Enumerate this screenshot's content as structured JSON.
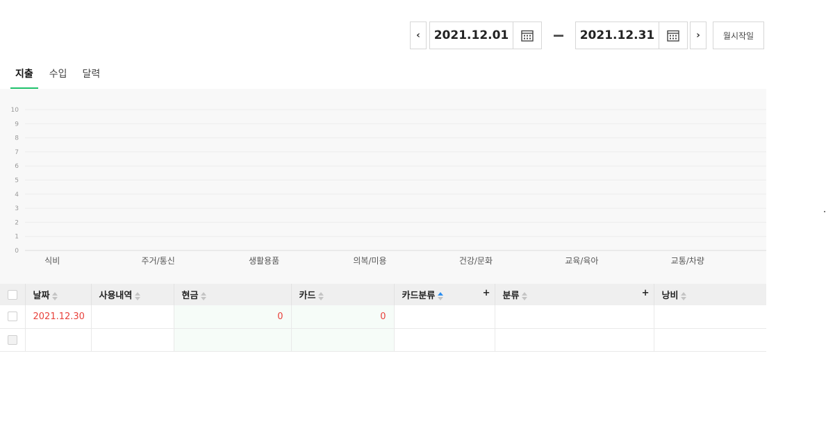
{
  "date_range": {
    "prev_label": "‹",
    "start_date": "2021.12.01",
    "separator": "–",
    "end_date": "2021.12.31",
    "next_label": "›",
    "month_start_label": "월시작일",
    "calendar_icon": "calendar-icon"
  },
  "tabs": [
    {
      "label": "지출",
      "active": true
    },
    {
      "label": "수입",
      "active": false
    },
    {
      "label": "달력",
      "active": false
    }
  ],
  "colors": {
    "accent_green": "#1ec26b",
    "negative_red": "#e8413b",
    "sort_active_blue": "#2b8ef0"
  },
  "chart_data": {
    "type": "bar",
    "categories": [
      "식비",
      "주거/통신",
      "생활용품",
      "의복/미용",
      "건강/문화",
      "교육/육아",
      "교통/차량"
    ],
    "values": [
      0,
      0,
      0,
      0,
      0,
      0,
      0
    ],
    "ylim": [
      0,
      10
    ],
    "yticks": [
      "0",
      "1",
      "2",
      "3",
      "4",
      "5",
      "6",
      "7",
      "8",
      "9",
      "10"
    ],
    "grid": true,
    "title": "",
    "xlabel": "",
    "ylabel": ""
  },
  "table": {
    "columns": [
      {
        "key": "date",
        "label": "날짜",
        "sort": "none"
      },
      {
        "key": "desc",
        "label": "사용내역",
        "sort": "none"
      },
      {
        "key": "cash",
        "label": "현금",
        "sort": "none"
      },
      {
        "key": "card",
        "label": "카드",
        "sort": "none"
      },
      {
        "key": "card_category",
        "label": "카드분류",
        "sort": "asc",
        "add": "+"
      },
      {
        "key": "category",
        "label": "분류",
        "sort": "none",
        "add": "+"
      },
      {
        "key": "waste",
        "label": "낭비",
        "sort": "none"
      }
    ],
    "rows": [
      {
        "date": "2021.12.30",
        "desc": "",
        "cash": "0",
        "card": "0",
        "card_category": "",
        "category": "",
        "waste": ""
      },
      {
        "date": "",
        "desc": "",
        "cash": "",
        "card": "",
        "card_category": "",
        "category": "",
        "waste": ""
      }
    ]
  }
}
